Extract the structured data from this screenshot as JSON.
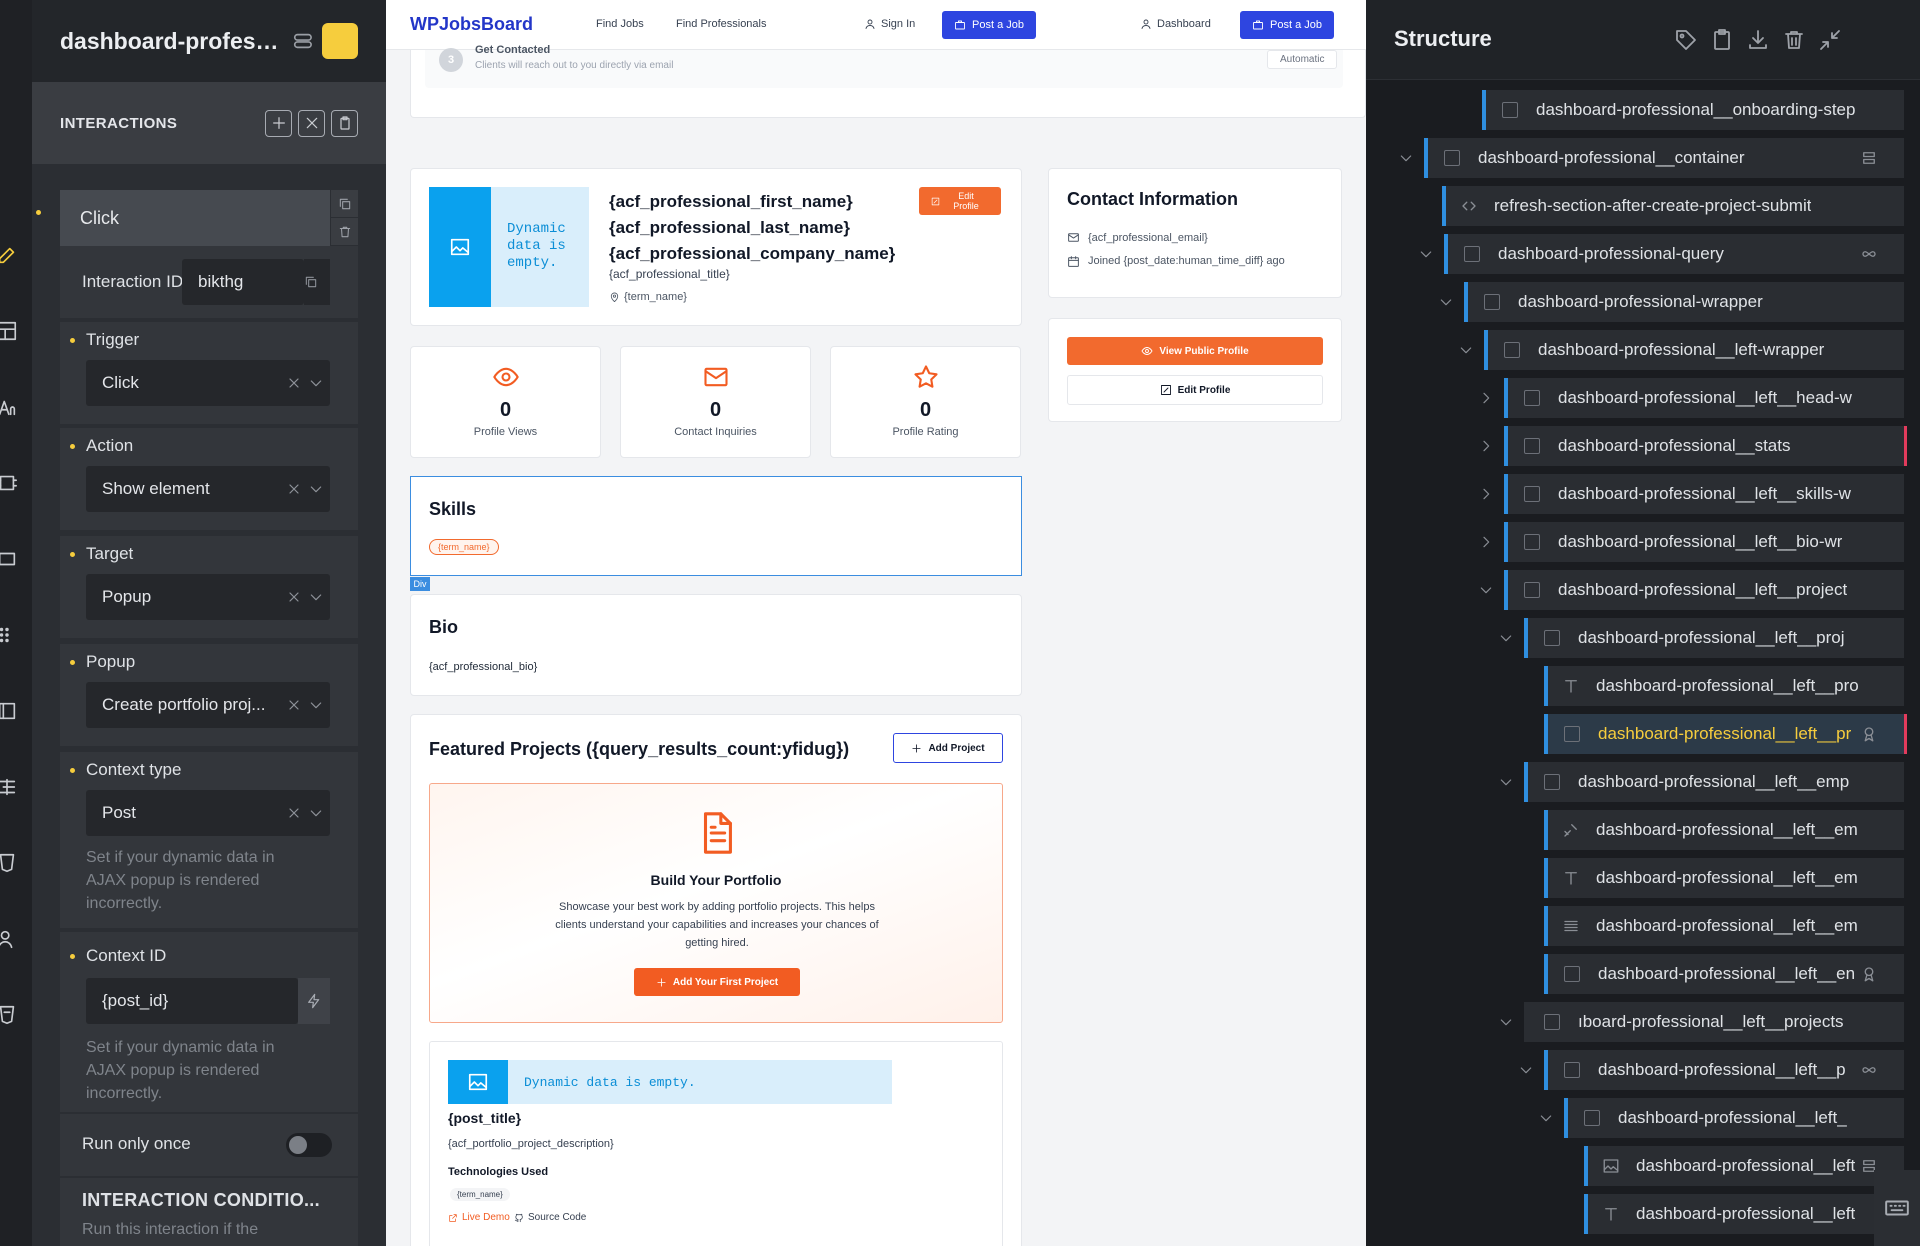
{
  "left_panel": {
    "title": "dashboard-professi...",
    "section_label": "INTERACTIONS",
    "interaction_selected": "Click",
    "interaction_id_label": "Interaction ID",
    "interaction_id_value": "bikthg",
    "trigger_label": "Trigger",
    "trigger_value": "Click",
    "action_label": "Action",
    "action_value": "Show element",
    "target_label": "Target",
    "target_value": "Popup",
    "popup_label": "Popup",
    "popup_value": "Create portfolio proj...",
    "context_type_label": "Context type",
    "context_type_value": "Post",
    "context_type_help": "Set if your dynamic data in AJAX popup is rendered incorrectly.",
    "context_id_label": "Context ID",
    "context_id_value": "{post_id}",
    "context_id_help": "Set if your dynamic data in AJAX popup is rendered incorrectly.",
    "run_once_label": "Run only once",
    "run_once_on": false,
    "conditions_label": "INTERACTION CONDITIO...",
    "conditions_help": "Run this interaction if the"
  },
  "site": {
    "brand": "WPJobsBoard",
    "nav_find_jobs": "Find Jobs",
    "nav_find_pros": "Find Professionals",
    "nav_sign_in": "Sign In",
    "nav_post_job": "Post a Job",
    "nav_dashboard": "Dashboard",
    "nav_post_job2": "Post a Job",
    "step_number": "3",
    "step_title": "Get Contacted",
    "step_desc": "Clients will reach out to you directly via email",
    "step_badge": "Automatic",
    "dynamic_empty": "Dynamic data is empty.",
    "first_name": "{acf_professional_first_name}",
    "last_name": "{acf_professional_last_name}",
    "company_name": "{acf_professional_company_name}",
    "title_field": "{acf_professional_title}",
    "location": "{term_name}",
    "edit_profile_badge": "Edit Profile",
    "stats": [
      {
        "value": "0",
        "label": "Profile Views",
        "icon": "eye-icon"
      },
      {
        "value": "0",
        "label": "Contact Inquiries",
        "icon": "mail-icon"
      },
      {
        "value": "0",
        "label": "Profile Rating",
        "icon": "star-icon"
      }
    ],
    "contact_title": "Contact Information",
    "contact_email": "{acf_professional_email}",
    "contact_joined": "Joined {post_date:human_time_diff} ago",
    "view_public_profile": "View Public Profile",
    "edit_profile": "Edit Profile",
    "skills_title": "Skills",
    "skills_tag": "{term_name}",
    "div_label": "Div",
    "bio_title": "Bio",
    "bio_text": "{acf_professional_bio}",
    "projects_title": "Featured Projects ({query_results_count:yfidug})",
    "add_project": "Add Project",
    "portfolio_title": "Build Your Portfolio",
    "portfolio_desc": "Showcase your best work by adding portfolio projects. This helps clients understand your capabilities and increases your chances of getting hired.",
    "add_first_project": "Add Your First Project",
    "project_dynamic_empty": "Dynamic data is empty.",
    "post_title": "{post_title}",
    "project_desc": "{acf_portfolio_project_description}",
    "tech_used": "Technologies Used",
    "tech_tag": "{term_name}",
    "live_demo": "Live Demo",
    "source_code": "Source Code"
  },
  "structure": {
    "title": "Structure",
    "rows": [
      {
        "label": "dashboard-professional__onboarding-step",
        "icon": "box-icon"
      },
      {
        "label": "dashboard-professional__container",
        "icon": "box-icon"
      },
      {
        "label": "refresh-section-after-create-project-submit",
        "icon": "code-icon"
      },
      {
        "label": "dashboard-professional-query",
        "icon": "box-icon"
      },
      {
        "label": "dashboard-professional-wrapper",
        "icon": "box-icon"
      },
      {
        "label": "dashboard-professional__left-wrapper",
        "icon": "box-icon"
      },
      {
        "label": "dashboard-professional__left__head-w",
        "icon": "box-icon"
      },
      {
        "label": "dashboard-professional__stats",
        "icon": "box-icon"
      },
      {
        "label": "dashboard-professional__left__skills-w",
        "icon": "box-icon"
      },
      {
        "label": "dashboard-professional__left__bio-wr",
        "icon": "box-icon"
      },
      {
        "label": "dashboard-professional__left__project",
        "icon": "box-icon"
      },
      {
        "label": "dashboard-professional__left__proj",
        "icon": "box-icon"
      },
      {
        "label": "dashboard-professional__left__pro",
        "icon": "text-icon"
      },
      {
        "label": "dashboard-professional__left__pr",
        "icon": "box-icon"
      },
      {
        "label": "dashboard-professional__left__emp",
        "icon": "box-icon"
      },
      {
        "label": "dashboard-professional__left__em",
        "icon": "shapes-icon"
      },
      {
        "label": "dashboard-professional__left__em",
        "icon": "text-icon"
      },
      {
        "label": "dashboard-professional__left__em",
        "icon": "lines-icon"
      },
      {
        "label": "dashboard-professional__left__en",
        "icon": "box-icon"
      },
      {
        "label": "ıboard-professional__left__projects",
        "icon": "box-icon"
      },
      {
        "label": "dashboard-professional__left__p",
        "icon": "box-icon"
      },
      {
        "label": "dashboard-professional__left_",
        "icon": "box-icon"
      },
      {
        "label": "dashboard-professional__left",
        "icon": "image-icon"
      },
      {
        "label": "dashboard-professional__left",
        "icon": "text-icon"
      }
    ]
  },
  "colors": {
    "accent_yellow": "#f6cd3d",
    "brand_blue": "#2e45e0",
    "orange": "#f25c22",
    "structure_bar": "#2f8fe0",
    "selected_text": "#f6cd3d"
  }
}
